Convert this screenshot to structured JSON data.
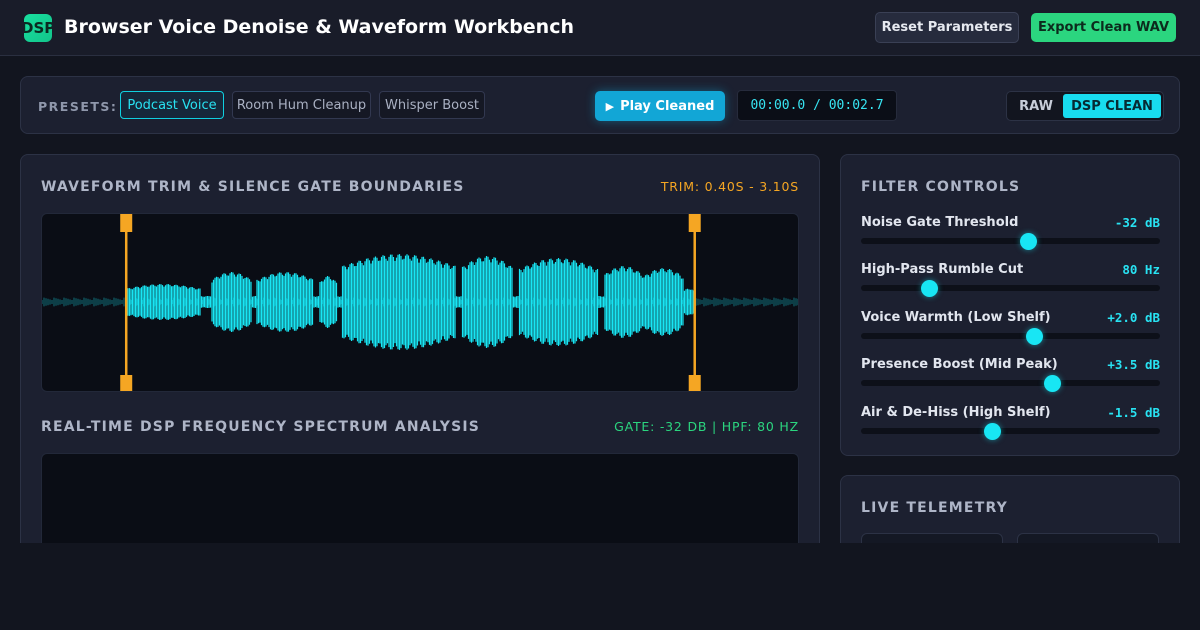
{
  "header": {
    "logo_text": "DSP",
    "title": "Browser Voice Denoise & Waveform Workbench",
    "reset_label": "Reset Parameters",
    "export_label": "Export Clean WAV"
  },
  "toolbar": {
    "presets_label": "PRESETS:",
    "presets": [
      {
        "label": "Podcast Voice",
        "active": true
      },
      {
        "label": "Room Hum Cleanup",
        "active": false
      },
      {
        "label": "Whisper Boost",
        "active": false
      }
    ],
    "play_icon": "play-icon",
    "play_glyph": "▶",
    "play_label": "Play Cleaned",
    "time_readout": "00:00.0 / 00:02.7",
    "mode_options": [
      "RAW",
      "DSP CLEAN"
    ],
    "mode_selected": "DSP CLEAN"
  },
  "waveform": {
    "title": "WAVEFORM TRIM & SILENCE GATE BOUNDARIES",
    "trim_readout": "TRIM: 0.40S - 3.10S",
    "duration_s": 3.6,
    "trim_start_s": 0.4,
    "trim_end_s": 3.1
  },
  "spectrum": {
    "title": "REAL-TIME DSP FREQUENCY SPECTRUM ANALYSIS",
    "readout": "GATE: -32 DB | HPF: 80 HZ"
  },
  "filters": {
    "title": "FILTER CONTROLS",
    "sliders": [
      {
        "label": "Noise Gate Threshold",
        "value": "-32 dB",
        "fraction": 0.56
      },
      {
        "label": "High-Pass Rumble Cut",
        "value": "80 Hz",
        "fraction": 0.23
      },
      {
        "label": "Voice Warmth (Low Shelf)",
        "value": "+2.0 dB",
        "fraction": 0.58
      },
      {
        "label": "Presence Boost (Mid Peak)",
        "value": "+3.5 dB",
        "fraction": 0.64
      },
      {
        "label": "Air & De-Hiss (High Shelf)",
        "value": "-1.5 dB",
        "fraction": 0.44
      }
    ]
  },
  "telemetry": {
    "title": "LIVE TELEMETRY"
  },
  "colors": {
    "accent": "#18e6f4",
    "trim_marker": "#f5a623",
    "spectrum_readout": "#2bd57f",
    "export": "#2bd57f"
  }
}
